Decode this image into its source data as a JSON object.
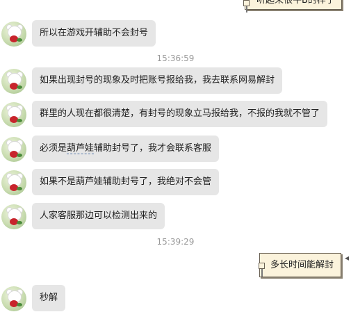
{
  "messages": {
    "top_note": "听起来很牛B的样子",
    "m1": "所以在游戏开辅助不会封号",
    "ts1": "15:36:59",
    "m2": "如果出现封号的现象及时把账号报给我，我去联系网易解封",
    "m3": "群里的人现在都很清楚，有封号的现象立马报给我，不报的我就不管了",
    "m4_pre": "必须是",
    "m4_ul": "葫芦娃",
    "m4_post": "辅助封号了，我才会联系客服",
    "m5": "如果不是葫芦娃辅助封号了，我绝对不会管",
    "m6": "人家客服那边可以检测出来的",
    "ts2": "15:39:29",
    "sent": "多长时间能解封",
    "m7": "秒解"
  },
  "colors": {
    "bubble_bg": "#e6e6e6",
    "timestamp": "#999999",
    "note_bg": "#fbf3dc"
  }
}
